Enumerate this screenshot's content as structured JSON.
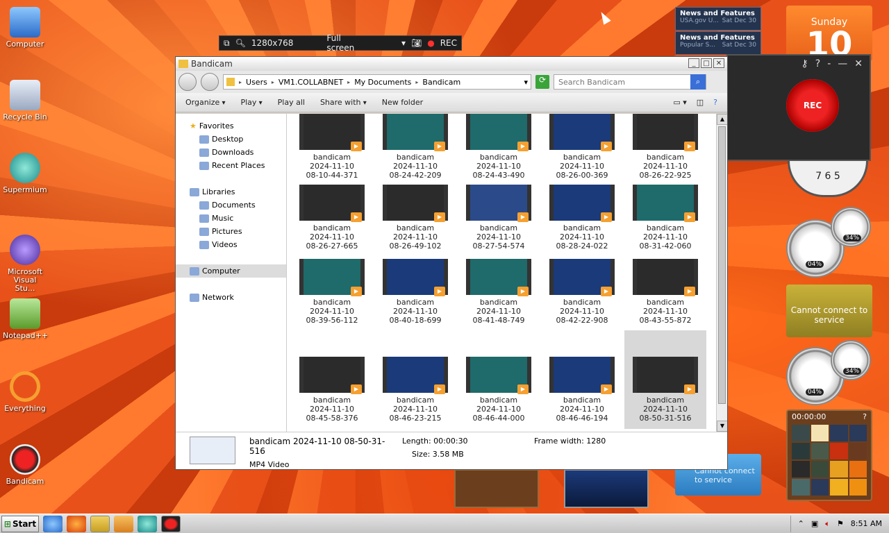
{
  "desktop": {
    "icons": [
      {
        "label": "Computer"
      },
      {
        "label": "Recycle Bin"
      },
      {
        "label": "Supermium"
      },
      {
        "label": "Microsoft Visual Stu..."
      },
      {
        "label": "Notepad++"
      },
      {
        "label": "Everything"
      },
      {
        "label": "Bandicam"
      }
    ]
  },
  "bandicam_bar": {
    "resolution": "1280x768",
    "mode": "Full screen",
    "rec": "REC"
  },
  "news": [
    {
      "title": "News and Features f...",
      "source": "USA.gov U...",
      "date": "Sat Dec 30"
    },
    {
      "title": "News and Features f...",
      "source": "Popular S...",
      "date": "Sat Dec 30"
    }
  ],
  "calendar": {
    "day": "Sunday",
    "num": "10"
  },
  "bandicam_panel": {
    "rec_label": "REC"
  },
  "clock": {
    "numbers": "7 6 5"
  },
  "gauges": {
    "pct_a": "04%",
    "pct_b": "34%"
  },
  "weather": {
    "message": "Cannot connect to service"
  },
  "puzzle": {
    "time": "00:00:00"
  },
  "explorer": {
    "title": "Bandicam",
    "breadcrumb": [
      "Users",
      "VM1.COLLABNET",
      "My Documents",
      "Bandicam"
    ],
    "search_placeholder": "Search Bandicam",
    "toolbar": {
      "organize": "Organize",
      "play": "Play",
      "play_all": "Play all",
      "share_with": "Share with",
      "new_folder": "New folder"
    },
    "nav": {
      "favorites": "Favorites",
      "desktop": "Desktop",
      "downloads": "Downloads",
      "recent": "Recent Places",
      "libraries": "Libraries",
      "documents": "Documents",
      "music": "Music",
      "pictures": "Pictures",
      "videos": "Videos",
      "computer": "Computer",
      "network": "Network"
    },
    "files": [
      {
        "name": "bandicam",
        "date": "2024-11-10",
        "time": "08-10-44-371"
      },
      {
        "name": "bandicam",
        "date": "2024-11-10",
        "time": "08-24-42-209"
      },
      {
        "name": "bandicam",
        "date": "2024-11-10",
        "time": "08-24-43-490"
      },
      {
        "name": "bandicam",
        "date": "2024-11-10",
        "time": "08-26-00-369"
      },
      {
        "name": "bandicam",
        "date": "2024-11-10",
        "time": "08-26-22-925"
      },
      {
        "name": "bandicam",
        "date": "2024-11-10",
        "time": "08-26-27-665"
      },
      {
        "name": "bandicam",
        "date": "2024-11-10",
        "time": "08-26-49-102"
      },
      {
        "name": "bandicam",
        "date": "2024-11-10",
        "time": "08-27-54-574"
      },
      {
        "name": "bandicam",
        "date": "2024-11-10",
        "time": "08-28-24-022"
      },
      {
        "name": "bandicam",
        "date": "2024-11-10",
        "time": "08-31-42-060"
      },
      {
        "name": "bandicam",
        "date": "2024-11-10",
        "time": "08-39-56-112"
      },
      {
        "name": "bandicam",
        "date": "2024-11-10",
        "time": "08-40-18-699"
      },
      {
        "name": "bandicam",
        "date": "2024-11-10",
        "time": "08-41-48-749"
      },
      {
        "name": "bandicam",
        "date": "2024-11-10",
        "time": "08-42-22-908"
      },
      {
        "name": "bandicam",
        "date": "2024-11-10",
        "time": "08-43-55-872"
      },
      {
        "name": "bandicam",
        "date": "2024-11-10",
        "time": "08-45-58-376"
      },
      {
        "name": "bandicam",
        "date": "2024-11-10",
        "time": "08-46-23-215"
      },
      {
        "name": "bandicam",
        "date": "2024-11-10",
        "time": "08-46-44-000"
      },
      {
        "name": "bandicam",
        "date": "2024-11-10",
        "time": "08-46-46-194"
      },
      {
        "name": "bandicam",
        "date": "2024-11-10",
        "time": "08-50-31-516"
      }
    ],
    "details": {
      "name": "bandicam 2024-11-10 08-50-31-516",
      "type": "MP4 Video",
      "length_label": "Length:",
      "length": "00:00:30",
      "size_label": "Size:",
      "size": "3.58 MB",
      "frame_label": "Frame width:",
      "frame": "1280"
    }
  },
  "taskbar": {
    "start": "Start",
    "time": "8:51 AM"
  }
}
